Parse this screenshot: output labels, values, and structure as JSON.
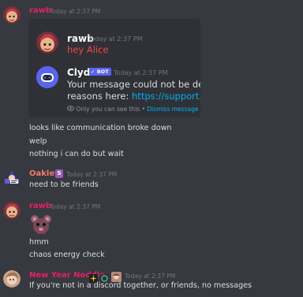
{
  "messages": {
    "m1": {
      "username": "rawb",
      "timestamp": "Today at 2:37 PM",
      "embed": {
        "quoted_user": "rawb",
        "quoted_timestamp": "Today at 2:37 PM",
        "quoted_text": "hey Alice",
        "bot_name": "Clyde",
        "bot_badge": "BOT",
        "bot_timestamp": "Today at 2:37 PM",
        "bot_line1": "Your message could not be delivered.",
        "bot_line2_prefix": "reasons here: ",
        "bot_line2_link": "https://support.discord.",
        "notice_text": "Only you can see this •",
        "notice_dismiss": "Dismiss message"
      },
      "lines": [
        "looks like communication broke down",
        "welp",
        "nothing i can do but wait"
      ]
    },
    "m2": {
      "username": "Oakley",
      "badge": "S",
      "timestamp": "Today at 2:37 PM",
      "lines": [
        "need to be friends"
      ]
    },
    "m3": {
      "username": "rawb",
      "timestamp": "Today at 2:37 PM",
      "lines": [
        "hmm",
        "chaos energy check"
      ]
    },
    "m4": {
      "username": "New Year Noddle",
      "timestamp": "Today at 2:37 PM",
      "lines": [
        "If you're not in a discord together, or friends, no messages"
      ]
    }
  },
  "colors": {
    "background": "#36393f",
    "rawb": "#e91e63",
    "oakley": "#f47b67",
    "noddle": "#e91e63",
    "link": "#00aff4",
    "bot_badge": "#5865f2"
  },
  "icons": {
    "eye": "eye-icon",
    "check": "verified-check-icon"
  }
}
